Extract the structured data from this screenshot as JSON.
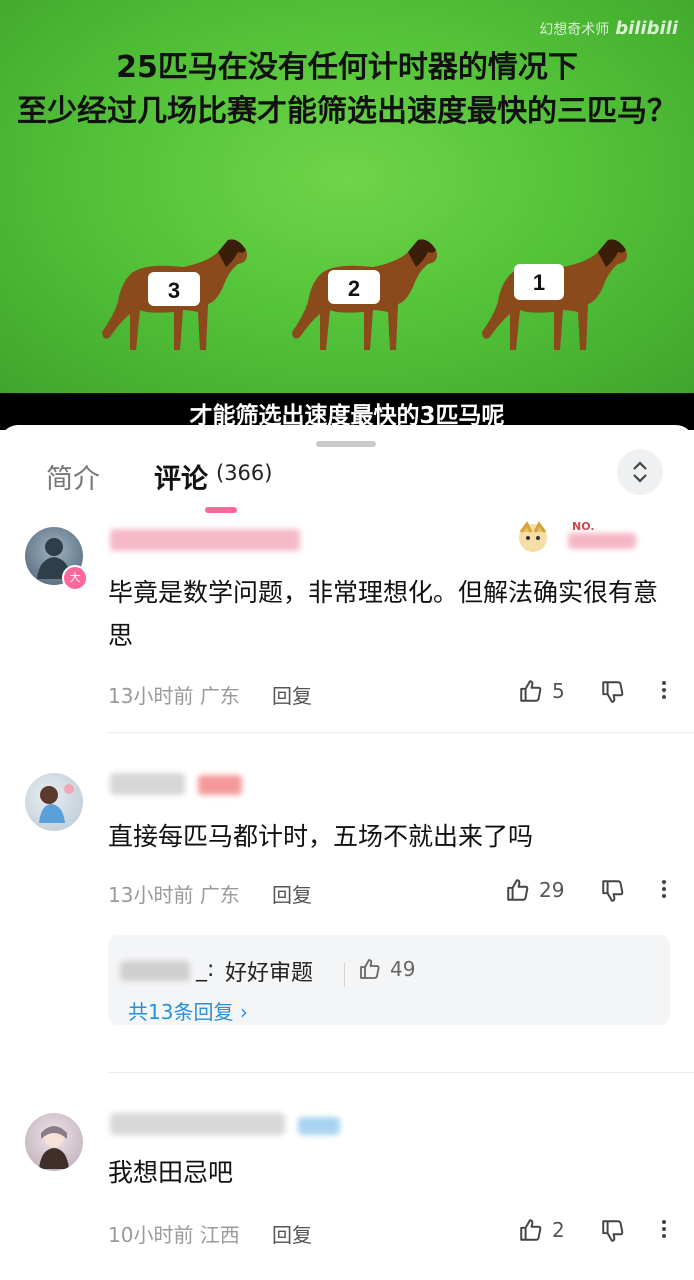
{
  "video": {
    "title_line1": "25匹马在没有任何计时器的情况下",
    "title_line2": "至少经过几场比赛才能筛选出速度最快的三匹马？",
    "watermark_text": "幻想奇术师",
    "watermark_brand": "bilibili",
    "horse_numbers": [
      "3",
      "2",
      "1"
    ],
    "subtitle": "才能筛选出速度最快的3匹马呢"
  },
  "tabs": {
    "intro": "简介",
    "comments": "评论",
    "count": "(366)"
  },
  "comments": [
    {
      "text": "毕竟是数学问题，非常理想化。但解法确实很有意思",
      "time": "13小时前",
      "location": "广东",
      "reply_label": "回复",
      "likes": "5",
      "badge": "NO."
    },
    {
      "text": "直接每匹马都计时，五场不就出来了吗",
      "time": "13小时前",
      "location": "广东",
      "reply_label": "回复",
      "likes": "29",
      "reply_preview": {
        "suffix": "_:",
        "text": "好好审题",
        "likes": "49",
        "more_label": "共13条回复"
      }
    },
    {
      "text": "我想田忌吧",
      "time": "10小时前",
      "location": "江西",
      "reply_label": "回复",
      "likes": "2"
    }
  ],
  "colors": {
    "accent": "#ff6699",
    "link": "#2a8fd8",
    "video_bg": "#55c43a"
  }
}
